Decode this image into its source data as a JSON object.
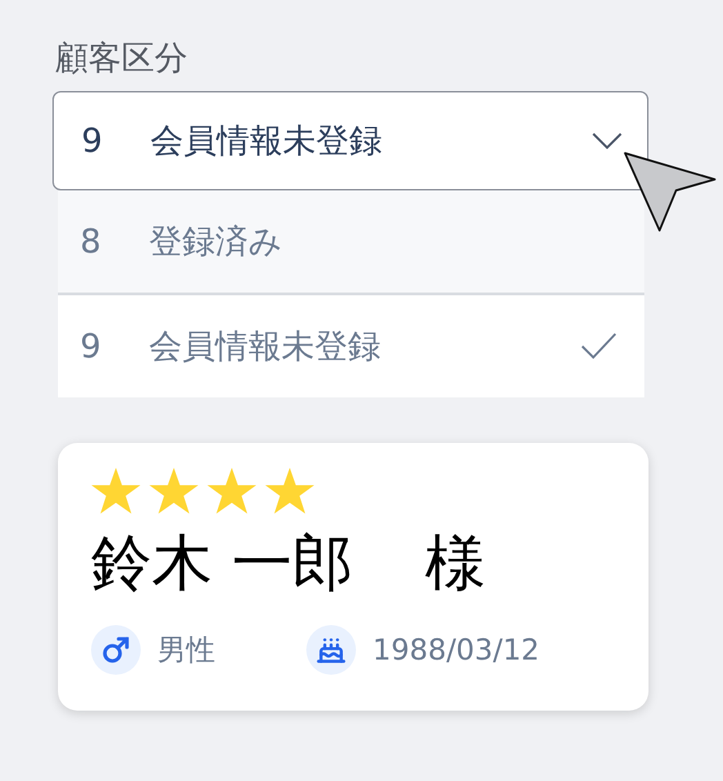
{
  "field": {
    "label": "顧客区分",
    "value_code": "9",
    "value_text": "会員情報未登録",
    "expanded": true
  },
  "options": [
    {
      "code": "8",
      "text": "登録済み",
      "selected": false
    },
    {
      "code": "9",
      "text": "会員情報未登録",
      "selected": true
    }
  ],
  "customer": {
    "stars": 4,
    "name": "鈴木 一郎",
    "honorific": "様",
    "gender": "男性",
    "birthday": "1988/03/12"
  }
}
